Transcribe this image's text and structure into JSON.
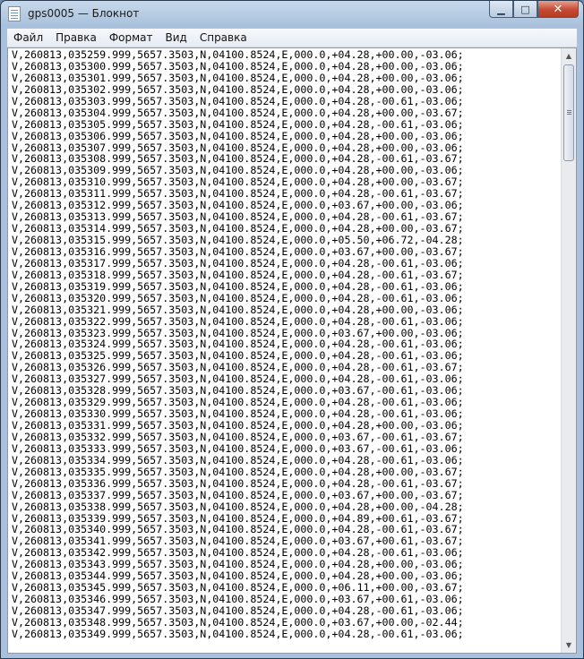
{
  "window": {
    "title": "gps0005 — Блокнот",
    "buttons": {
      "minimize": "▁",
      "maximize": "□",
      "close": "✕"
    }
  },
  "menu": [
    "Файл",
    "Правка",
    "Формат",
    "Вид",
    "Справка"
  ],
  "editor": {
    "lines": [
      "V,260813,035259.999,5657.3503,N,04100.8524,E,000.0,+04.28,+00.00,-03.06;",
      "V,260813,035300.999,5657.3503,N,04100.8524,E,000.0,+04.28,+00.00,-03.06;",
      "V,260813,035301.999,5657.3503,N,04100.8524,E,000.0,+04.28,+00.00,-03.06;",
      "V,260813,035302.999,5657.3503,N,04100.8524,E,000.0,+04.28,+00.00,-03.06;",
      "V,260813,035303.999,5657.3503,N,04100.8524,E,000.0,+04.28,-00.61,-03.06;",
      "V,260813,035304.999,5657.3503,N,04100.8524,E,000.0,+04.28,+00.00,-03.67;",
      "V,260813,035305.999,5657.3503,N,04100.8524,E,000.0,+04.28,-00.61,-03.06;",
      "V,260813,035306.999,5657.3503,N,04100.8524,E,000.0,+04.28,+00.00,-03.06;",
      "V,260813,035307.999,5657.3503,N,04100.8524,E,000.0,+04.28,+00.00,-03.06;",
      "V,260813,035308.999,5657.3503,N,04100.8524,E,000.0,+04.28,-00.61,-03.67;",
      "V,260813,035309.999,5657.3503,N,04100.8524,E,000.0,+04.28,+00.00,-03.06;",
      "V,260813,035310.999,5657.3503,N,04100.8524,E,000.0,+04.28,+00.00,-03.67;",
      "V,260813,035311.999,5657.3503,N,04100.8524,E,000.0,+04.28,-00.61,-03.67;",
      "V,260813,035312.999,5657.3503,N,04100.8524,E,000.0,+03.67,+00.00,-03.06;",
      "V,260813,035313.999,5657.3503,N,04100.8524,E,000.0,+04.28,-00.61,-03.67;",
      "V,260813,035314.999,5657.3503,N,04100.8524,E,000.0,+04.28,+00.00,-03.67;",
      "V,260813,035315.999,5657.3503,N,04100.8524,E,000.0,+05.50,+06.72,-04.28;",
      "V,260813,035316.999,5657.3503,N,04100.8524,E,000.0,+03.67,+00.00,-03.67;",
      "V,260813,035317.999,5657.3503,N,04100.8524,E,000.0,+04.28,-00.61,-03.06;",
      "V,260813,035318.999,5657.3503,N,04100.8524,E,000.0,+04.28,-00.61,-03.67;",
      "V,260813,035319.999,5657.3503,N,04100.8524,E,000.0,+04.28,-00.61,-03.06;",
      "V,260813,035320.999,5657.3503,N,04100.8524,E,000.0,+04.28,-00.61,-03.06;",
      "V,260813,035321.999,5657.3503,N,04100.8524,E,000.0,+04.28,+00.00,-03.06;",
      "V,260813,035322.999,5657.3503,N,04100.8524,E,000.0,+04.28,-00.61,-03.06;",
      "V,260813,035323.999,5657.3503,N,04100.8524,E,000.0,+03.67,+00.00,-03.06;",
      "V,260813,035324.999,5657.3503,N,04100.8524,E,000.0,+04.28,-00.61,-03.06;",
      "V,260813,035325.999,5657.3503,N,04100.8524,E,000.0,+04.28,-00.61,-03.06;",
      "V,260813,035326.999,5657.3503,N,04100.8524,E,000.0,+04.28,-00.61,-03.67;",
      "V,260813,035327.999,5657.3503,N,04100.8524,E,000.0,+04.28,-00.61,-03.06;",
      "V,260813,035328.999,5657.3503,N,04100.8524,E,000.0,+03.67,-00.61,-03.06;",
      "V,260813,035329.999,5657.3503,N,04100.8524,E,000.0,+04.28,-00.61,-03.06;",
      "V,260813,035330.999,5657.3503,N,04100.8524,E,000.0,+04.28,-00.61,-03.06;",
      "V,260813,035331.999,5657.3503,N,04100.8524,E,000.0,+04.28,+00.00,-03.06;",
      "V,260813,035332.999,5657.3503,N,04100.8524,E,000.0,+03.67,-00.61,-03.67;",
      "V,260813,035333.999,5657.3503,N,04100.8524,E,000.0,+03.67,-00.61,-03.06;",
      "V,260813,035334.999,5657.3503,N,04100.8524,E,000.0,+04.28,-00.61,-03.06;",
      "V,260813,035335.999,5657.3503,N,04100.8524,E,000.0,+04.28,+00.00,-03.67;",
      "V,260813,035336.999,5657.3503,N,04100.8524,E,000.0,+04.28,-00.61,-03.67;",
      "V,260813,035337.999,5657.3503,N,04100.8524,E,000.0,+03.67,+00.00,-03.67;",
      "V,260813,035338.999,5657.3503,N,04100.8524,E,000.0,+04.28,+00.00,-04.28;",
      "V,260813,035339.999,5657.3503,N,04100.8524,E,000.0,+04.89,+00.61,-03.67;",
      "V,260813,035340.999,5657.3503,N,04100.8524,E,000.0,+04.28,-00.61,-03.67;",
      "V,260813,035341.999,5657.3503,N,04100.8524,E,000.0,+03.67,+00.61,-03.67;",
      "V,260813,035342.999,5657.3503,N,04100.8524,E,000.0,+04.28,-00.61,-03.06;",
      "V,260813,035343.999,5657.3503,N,04100.8524,E,000.0,+04.28,+00.00,-03.06;",
      "V,260813,035344.999,5657.3503,N,04100.8524,E,000.0,+04.28,+00.00,-03.06;",
      "V,260813,035345.999,5657.3503,N,04100.8524,E,000.0,+06.11,+00.00,-03.67;",
      "V,260813,035346.999,5657.3503,N,04100.8524,E,000.0,+03.67,+00.61,-03.06;",
      "V,260813,035347.999,5657.3503,N,04100.8524,E,000.0,+04.28,-00.61,-03.06;",
      "V,260813,035348.999,5657.3503,N,04100.8524,E,000.0,+03.67,+00.00,-02.44;",
      "V,260813,035349.999,5657.3503,N,04100.8524,E,000.0,+04.28,-00.61,-03.06;"
    ]
  },
  "colors": {
    "title_bar": "#a9c1dc",
    "close_button": "#c44a32",
    "text": "#000000",
    "editor_bg": "#ffffff"
  },
  "icons": [
    "notepad-icon",
    "minimize-icon",
    "maximize-icon",
    "close-icon",
    "scroll-up-arrow-icon",
    "scroll-down-arrow-icon"
  ]
}
